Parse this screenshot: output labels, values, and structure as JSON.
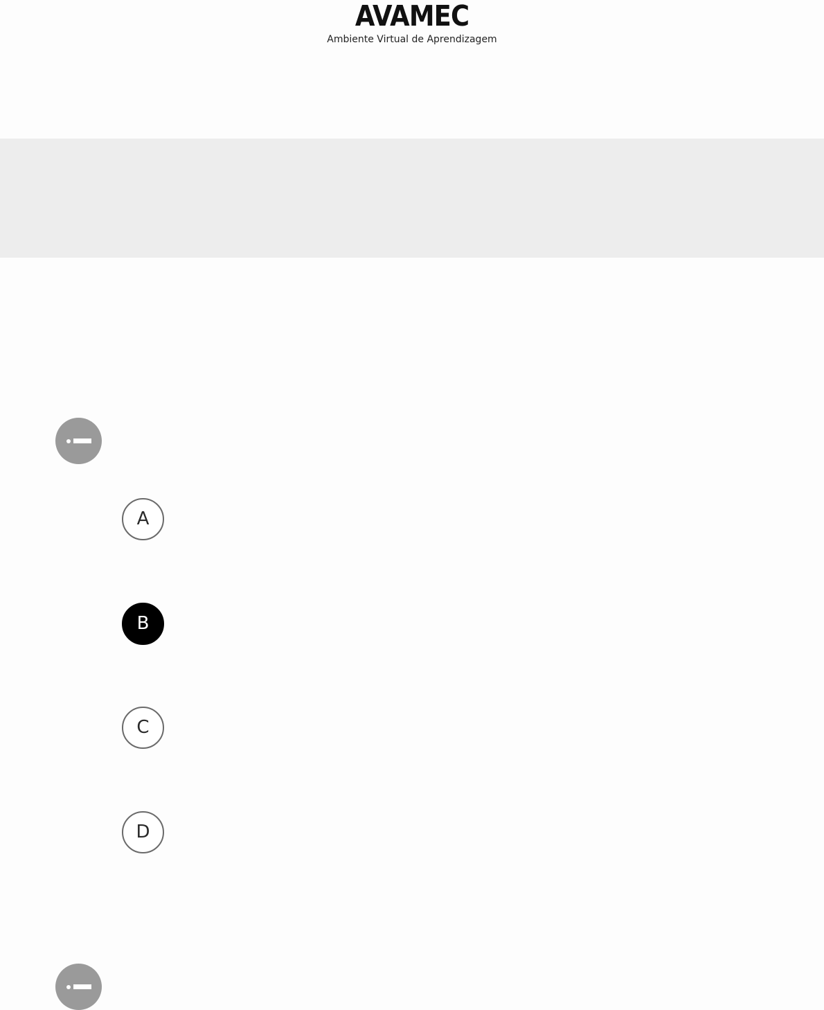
{
  "header": {
    "logo_text": "AVAMEC",
    "subtitle": "Ambiente Virtual de Aprendizagem"
  },
  "questions": [
    {
      "status_icon": "minus-circle-icon",
      "options": [
        {
          "letter": "A",
          "selected": false
        },
        {
          "letter": "B",
          "selected": true
        },
        {
          "letter": "C",
          "selected": false
        },
        {
          "letter": "D",
          "selected": false
        }
      ]
    },
    {
      "status_icon": "minus-circle-icon"
    }
  ],
  "colors": {
    "banner": "#ededed",
    "status_icon": "#9a9a9a",
    "selected_option": "#000000",
    "option_border": "#6a6a6a"
  }
}
